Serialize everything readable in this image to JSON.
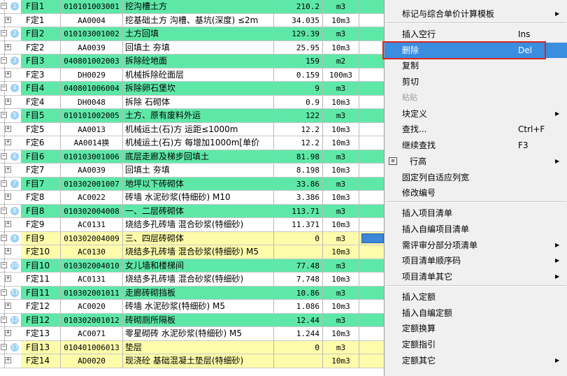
{
  "rows": [
    {
      "name": "F目1",
      "code": "010101003001",
      "desc": "挖沟槽土方",
      "qty": "210.2",
      "unit": "m3",
      "kind": "green",
      "num": "1"
    },
    {
      "name": "F定1",
      "code": "AA0004",
      "desc": "挖基础土方 沟槽、基坑(深度) ≤2m",
      "qty": "34.035",
      "unit": "10m3",
      "kind": "white"
    },
    {
      "name": "F目2",
      "code": "010103001002",
      "desc": "土方回填",
      "qty": "129.39",
      "unit": "m3",
      "kind": "green",
      "num": "2"
    },
    {
      "name": "F定2",
      "code": "AA0039",
      "desc": "回填土 夯填",
      "qty": "25.95",
      "unit": "10m3",
      "kind": "white"
    },
    {
      "name": "F目3",
      "code": "040801002003",
      "desc": "拆除砼地面",
      "qty": "159",
      "unit": "m2",
      "kind": "green",
      "num": "3"
    },
    {
      "name": "F定3",
      "code": "DH0029",
      "desc": "机械拆除砼面层",
      "qty": "0.159",
      "unit": "100m3",
      "kind": "white"
    },
    {
      "name": "F目4",
      "code": "040801006004",
      "desc": "拆除卵石堡坎",
      "qty": "9",
      "unit": "m3",
      "kind": "green",
      "num": "4"
    },
    {
      "name": "F定4",
      "code": "DH0048",
      "desc": "拆除 石砌体",
      "qty": "0.9",
      "unit": "10m3",
      "kind": "white"
    },
    {
      "name": "F目5",
      "code": "010101002005",
      "desc": "土方、原有废料外运",
      "qty": "122",
      "unit": "m3",
      "kind": "green",
      "num": "5"
    },
    {
      "name": "F定5",
      "code": "AA0013",
      "desc": "机械运土(石)方 运距≤1000m",
      "qty": "12.2",
      "unit": "10m3",
      "kind": "white"
    },
    {
      "name": "F定6",
      "code": "AA0014换",
      "desc": "机械运土(石)方 每增加1000m[单价",
      "qty": "12.2",
      "unit": "10m3",
      "kind": "white"
    },
    {
      "name": "F目6",
      "code": "010103001006",
      "desc": "底层走廊及梯步回填土",
      "qty": "81.98",
      "unit": "m3",
      "kind": "green",
      "num": "6"
    },
    {
      "name": "F定7",
      "code": "AA0039",
      "desc": "回填土 夯填",
      "qty": "8.198",
      "unit": "10m3",
      "kind": "white"
    },
    {
      "name": "F目7",
      "code": "010302001007",
      "desc": "地坪以下砖砌体",
      "qty": "33.86",
      "unit": "m3",
      "kind": "green",
      "num": "7"
    },
    {
      "name": "F定8",
      "code": "AC0022",
      "desc": "砖墙 水泥砂浆(特细砂) M10",
      "qty": "3.386",
      "unit": "10m3",
      "kind": "white"
    },
    {
      "name": "F目8",
      "code": "010302004008",
      "desc": "一、二层砖砌体",
      "qty": "113.71",
      "unit": "m3",
      "kind": "green",
      "num": "8"
    },
    {
      "name": "F定9",
      "code": "AC0131",
      "desc": "烧结多孔砖墙 混合砂浆(特细砂)",
      "qty": "11.371",
      "unit": "10m3",
      "kind": "white"
    },
    {
      "name": "F目9",
      "code": "010302004009",
      "desc": "三、四层砖砌体",
      "qty": "0",
      "unit": "m3",
      "kind": "yellow",
      "num": "9",
      "selected": true
    },
    {
      "name": "F定10",
      "code": "AC0130",
      "desc": "烧结多孔砖墙 混合砂浆(特细砂) M5",
      "qty": "",
      "unit": "10m3",
      "kind": "yellow"
    },
    {
      "name": "F目10",
      "code": "010302004010",
      "desc": "女儿墙和楼梯间",
      "qty": "77.48",
      "unit": "m3",
      "kind": "green",
      "num": "10"
    },
    {
      "name": "F定11",
      "code": "AC0131",
      "desc": "烧结多孔砖墙 混合砂浆(特细砂)",
      "qty": "7.748",
      "unit": "10m3",
      "kind": "white"
    },
    {
      "name": "F目11",
      "code": "010302001011",
      "desc": "走廊砖砌挡板",
      "qty": "10.86",
      "unit": "m3",
      "kind": "green",
      "num": "11"
    },
    {
      "name": "F定12",
      "code": "AC0020",
      "desc": "砖墙 水泥砂浆(特细砂) M5",
      "qty": "1.086",
      "unit": "10m3",
      "kind": "white"
    },
    {
      "name": "F目12",
      "code": "010302001012",
      "desc": "砖砌厕所隔板",
      "qty": "12.44",
      "unit": "m3",
      "kind": "green",
      "num": "12"
    },
    {
      "name": "F定13",
      "code": "AC0071",
      "desc": "零星砌砖 水泥砂浆(特细砂) M5",
      "qty": "1.244",
      "unit": "10m3",
      "kind": "white"
    },
    {
      "name": "F目13",
      "code": "010401006013",
      "desc": "垫层",
      "qty": "0",
      "unit": "m3",
      "kind": "yellow",
      "num": "13"
    },
    {
      "name": "F定14",
      "code": "AD0020",
      "desc": "现浇砼 基础混凝土垫层(特细砂)",
      "qty": "",
      "unit": "10m3",
      "kind": "yellow"
    }
  ],
  "menu": {
    "groups": [
      [
        {
          "label": "标记与综合单价计算模板",
          "shortcut": "",
          "arrow": true
        }
      ],
      [
        {
          "label": "插入空行",
          "shortcut": "Ins"
        },
        {
          "label": "删除",
          "shortcut": "Del",
          "highlight": true
        },
        {
          "label": "复制",
          "shortcut": ""
        },
        {
          "label": "剪切",
          "shortcut": ""
        },
        {
          "label": "粘贴",
          "shortcut": "",
          "disabled": true
        },
        {
          "label": "块定义",
          "shortcut": "",
          "arrow": true
        },
        {
          "label": "查找...",
          "shortcut": "Ctrl+F"
        },
        {
          "label": "继续查找",
          "shortcut": "F3"
        },
        {
          "label": "行高",
          "shortcut": "",
          "arrow": true,
          "icon": true
        },
        {
          "label": "固定列自适应列宽",
          "shortcut": ""
        },
        {
          "label": "修改编号",
          "shortcut": ""
        }
      ],
      [
        {
          "label": "插入项目清单",
          "shortcut": ""
        },
        {
          "label": "插入自编项目清单",
          "shortcut": ""
        },
        {
          "label": "需评审分部分项清单",
          "shortcut": "",
          "arrow": true
        },
        {
          "label": "项目清单顺序码",
          "shortcut": "",
          "arrow": true
        },
        {
          "label": "项目清单其它",
          "shortcut": "",
          "arrow": true
        }
      ],
      [
        {
          "label": "插入定额",
          "shortcut": ""
        },
        {
          "label": "插入自编定额",
          "shortcut": ""
        },
        {
          "label": "定额换算",
          "shortcut": ""
        },
        {
          "label": "定额指引",
          "shortcut": ""
        },
        {
          "label": "定额其它",
          "shortcut": "",
          "arrow": true
        }
      ]
    ]
  }
}
